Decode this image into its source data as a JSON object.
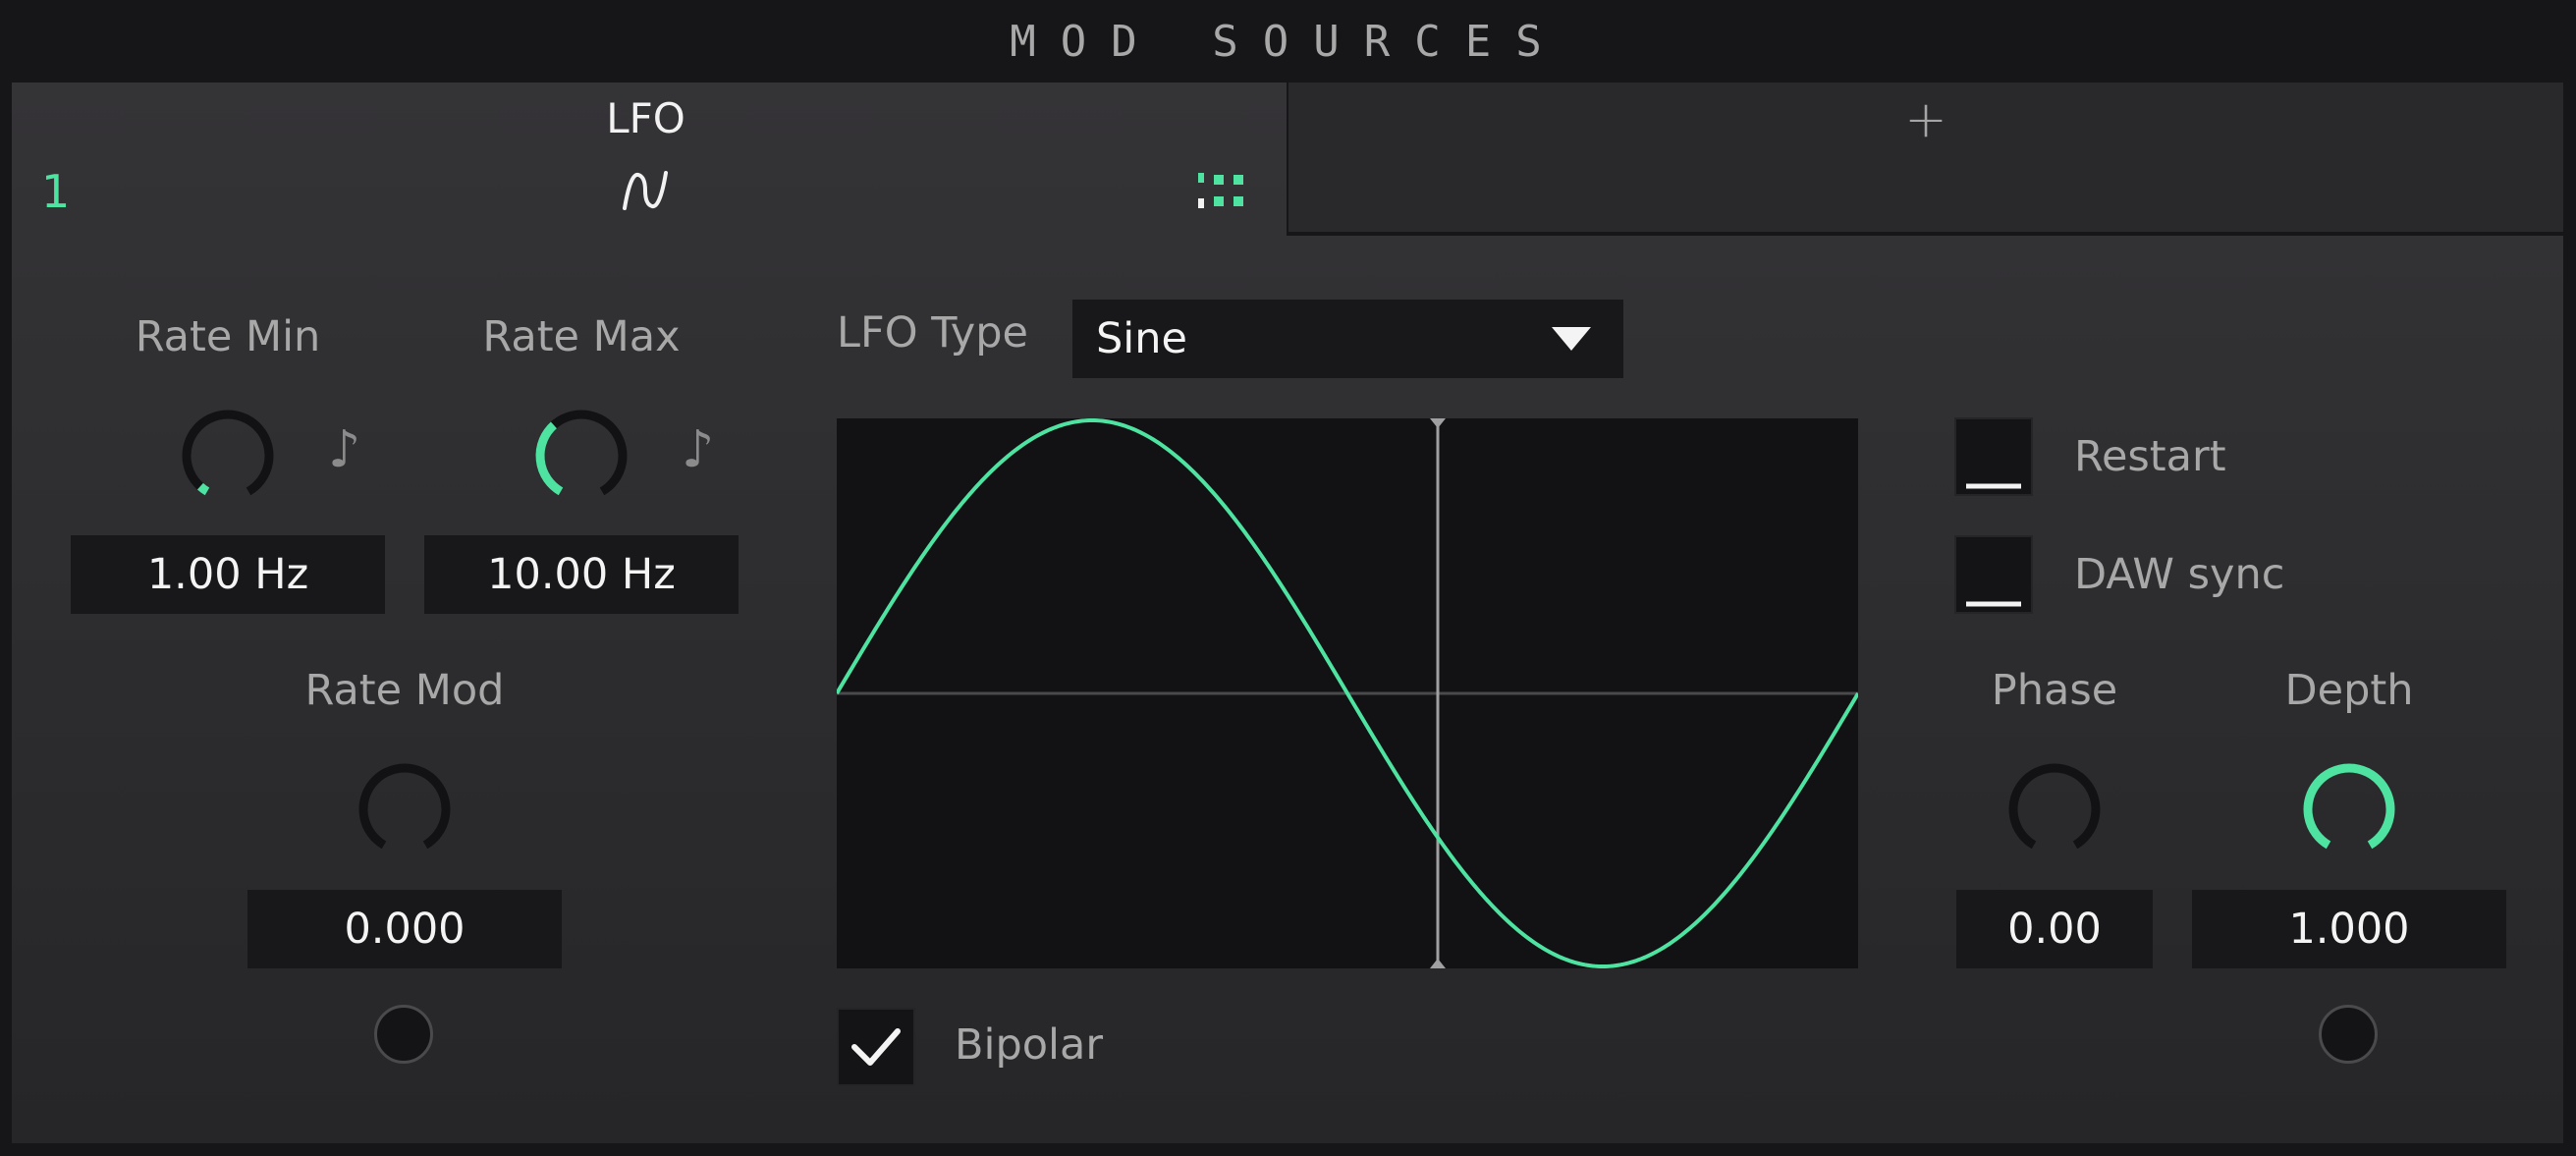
{
  "header": {
    "title": "MOD SOURCES"
  },
  "tab": {
    "title": "LFO",
    "slot_number": "1",
    "add_tab_label": "+"
  },
  "rate_min": {
    "label": "Rate Min",
    "value": "1.00 Hz",
    "knob_level": 0.04
  },
  "rate_max": {
    "label": "Rate Max",
    "value": "10.00 Hz",
    "knob_level": 0.36
  },
  "rate_mod": {
    "label": "Rate Mod",
    "value": "0.000",
    "knob_level": 0.0
  },
  "lfo_type": {
    "label": "LFO Type",
    "selected": "Sine"
  },
  "bipolar": {
    "label": "Bipolar",
    "checked": true
  },
  "restart": {
    "label": "Restart",
    "checked": false
  },
  "daw_sync": {
    "label": "DAW sync",
    "checked": false
  },
  "phase": {
    "label": "Phase",
    "value": "0.00",
    "knob_level": 0.0
  },
  "depth": {
    "label": "Depth",
    "value": "1.000",
    "knob_level": 1.0
  },
  "colors": {
    "accent": "#4fe3a2",
    "knob_track": "#121214",
    "background": "#2e2e31"
  },
  "icons": {
    "wave": "sine-wave-icon",
    "grid": "grid-dots-icon",
    "note": "music-note-icon",
    "dropdown": "triangle-down-icon"
  }
}
